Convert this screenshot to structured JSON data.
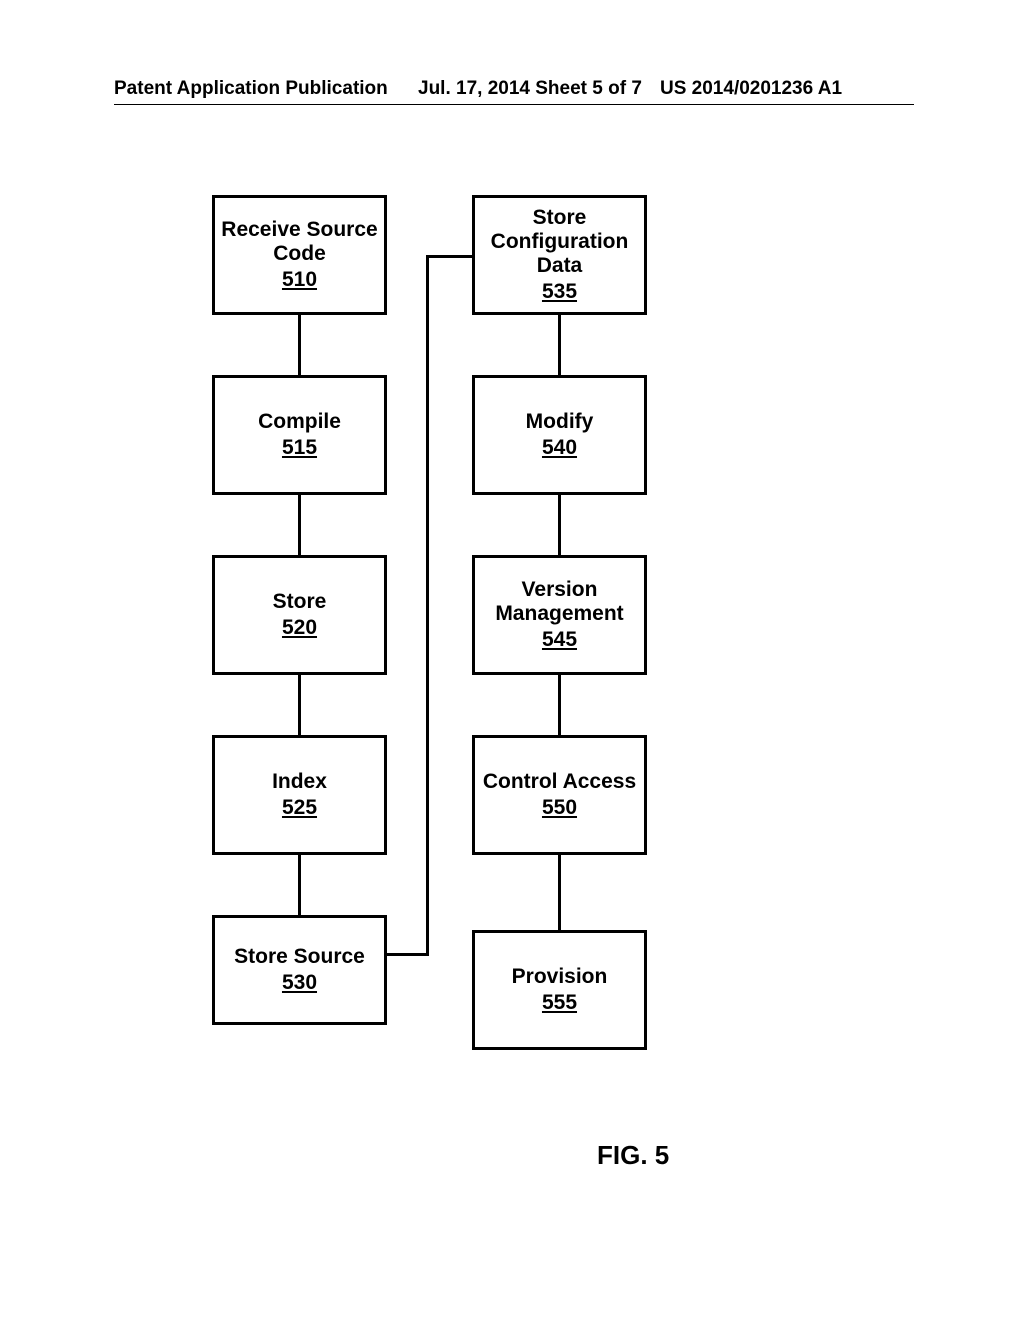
{
  "header": {
    "left": "Patent Application Publication",
    "center": "Jul. 17, 2014  Sheet 5 of 7",
    "right": "US 2014/0201236 A1"
  },
  "figure_label": "FIG. 5",
  "boxes": {
    "b510": {
      "title": "Receive Source\nCode",
      "num": "510"
    },
    "b515": {
      "title": "Compile",
      "num": "515"
    },
    "b520": {
      "title": "Store",
      "num": "520"
    },
    "b525": {
      "title": "Index",
      "num": "525"
    },
    "b530": {
      "title": "Store Source",
      "num": "530"
    },
    "b535": {
      "title": "Store\nConfiguration\nData",
      "num": "535"
    },
    "b540": {
      "title": "Modify",
      "num": "540"
    },
    "b545": {
      "title": "Version\nManagement",
      "num": "545"
    },
    "b550": {
      "title": "Control Access",
      "num": "550"
    },
    "b555": {
      "title": "Provision",
      "num": "555"
    }
  }
}
